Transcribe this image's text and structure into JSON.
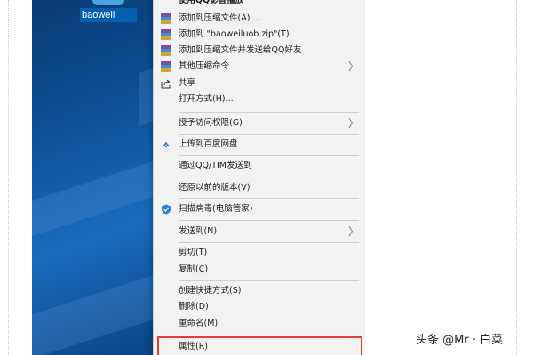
{
  "desktop": {
    "icon_label": "baoweil"
  },
  "menu": {
    "items": [
      {
        "label": "使用QQ影音播放",
        "icon": "qq-player-icon",
        "submenu": false
      },
      {
        "label": "添加到压缩文件(A) ...",
        "icon": "archive-icon",
        "submenu": false
      },
      {
        "label": "添加到 \"baoweiluob.zip\"(T)",
        "icon": "archive-icon",
        "submenu": false
      },
      {
        "label": "添加到压缩文件并发送给QQ好友",
        "icon": "archive-icon",
        "submenu": false
      },
      {
        "label": "其他压缩命令",
        "icon": "archive-icon",
        "submenu": true
      },
      {
        "label": "共享",
        "icon": "share-icon",
        "submenu": false
      },
      {
        "label": "打开方式(H)...",
        "icon": "",
        "submenu": false
      },
      {
        "label": "授予访问权限(G)",
        "icon": "",
        "submenu": true
      },
      {
        "label": "上传到百度网盘",
        "icon": "baidu-cloud-icon",
        "submenu": false
      },
      {
        "label": "通过QQ/TIM发送到",
        "icon": "",
        "submenu": false
      },
      {
        "label": "还原以前的版本(V)",
        "icon": "",
        "submenu": false
      },
      {
        "label": "扫描病毒(电脑管家)",
        "icon": "shield-icon",
        "submenu": false
      },
      {
        "label": "发送到(N)",
        "icon": "",
        "submenu": true
      },
      {
        "label": "剪切(T)",
        "icon": "",
        "submenu": false
      },
      {
        "label": "复制(C)",
        "icon": "",
        "submenu": false
      },
      {
        "label": "创建快捷方式(S)",
        "icon": "",
        "submenu": false
      },
      {
        "label": "删除(D)",
        "icon": "",
        "submenu": false
      },
      {
        "label": "重命名(M)",
        "icon": "",
        "submenu": false
      },
      {
        "label": "属性(R)",
        "icon": "",
        "submenu": false
      }
    ],
    "submenu_arrow": "〉"
  },
  "highlight_color": "#e03c3c",
  "watermark": "头条 @Mr · 白菜"
}
